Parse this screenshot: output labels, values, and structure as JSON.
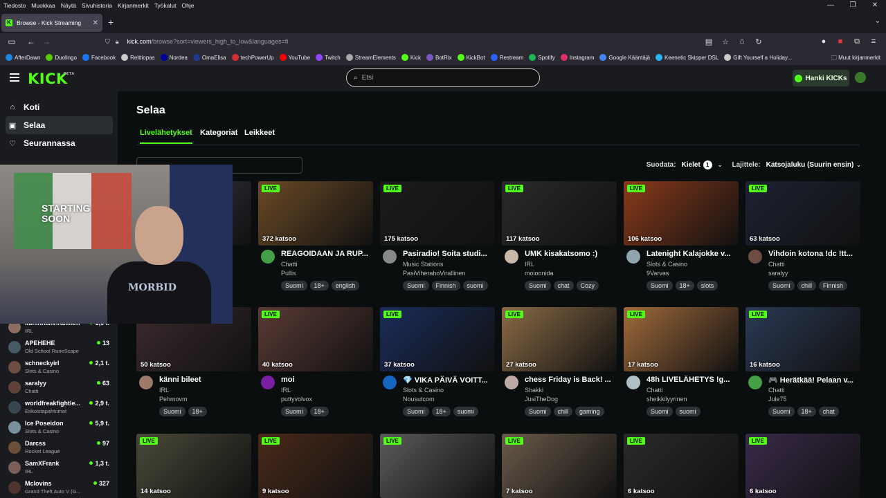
{
  "os_menu": [
    "Tiedosto",
    "Muokkaa",
    "Näytä",
    "Sivuhistoria",
    "Kirjanmerkit",
    "Työkalut",
    "Ohje"
  ],
  "browser": {
    "tab_title": "Browse - Kick Streaming",
    "url_host": "kick.com",
    "url_path": "/browse?sort=viewers_high_to_low&languages=fi"
  },
  "bookmarks": [
    {
      "label": "AfterDawn",
      "color": "#1e88e5"
    },
    {
      "label": "Duolingo",
      "color": "#58cc02"
    },
    {
      "label": "Facebook",
      "color": "#1877f2"
    },
    {
      "label": "Reittiopas",
      "color": "#ccc"
    },
    {
      "label": "Nordea",
      "color": "#0000a0"
    },
    {
      "label": "OmaElisa",
      "color": "#1e3a8a"
    },
    {
      "label": "techPowerUp",
      "color": "#d32f2f"
    },
    {
      "label": "YouTube",
      "color": "#ff0000"
    },
    {
      "label": "Twitch",
      "color": "#9146ff"
    },
    {
      "label": "StreamElements",
      "color": "#aaa"
    },
    {
      "label": "Kick",
      "color": "#53fc18"
    },
    {
      "label": "BotRix",
      "color": "#7e57c2"
    },
    {
      "label": "KickBot",
      "color": "#53fc18"
    },
    {
      "label": "Restream",
      "color": "#2962ff"
    },
    {
      "label": "Spotify",
      "color": "#1db954"
    },
    {
      "label": "Instagram",
      "color": "#e1306c"
    },
    {
      "label": "Google Kääntäjä",
      "color": "#4285f4"
    },
    {
      "label": "Keenetic Skipper DSL",
      "color": "#29b6f6"
    },
    {
      "label": "Gift Yourself a Holiday...",
      "color": "#ccc"
    }
  ],
  "bookmarks_other": "Muut kirjanmerkit",
  "header": {
    "logo": "KICK",
    "logo_beta": "BETA",
    "search_placeholder": "Etsi",
    "kicks_button": "Hanki KICKs"
  },
  "sidebar": {
    "nav": [
      {
        "label": "Koti",
        "icon": "home-icon"
      },
      {
        "label": "Selaa",
        "icon": "browse-icon"
      },
      {
        "label": "Seurannassa",
        "icon": "heart-icon"
      }
    ],
    "channels": [
      {
        "name": "kuninnanvirallinen",
        "category": "IRL",
        "viewers": "1,6 t.",
        "color": "#8d6e63"
      },
      {
        "name": "APEHEHE",
        "category": "Old School RuneScape",
        "viewers": "13",
        "color": "#455a64"
      },
      {
        "name": "schneckyirl",
        "category": "Slots & Casino",
        "viewers": "2,1 t.",
        "color": "#6d4c41"
      },
      {
        "name": "saralyy",
        "category": "Chatti",
        "viewers": "63",
        "color": "#5d4037"
      },
      {
        "name": "worldfreakfightle...",
        "category": "Erikoistapahtumat",
        "viewers": "2,9 t.",
        "color": "#37474f"
      },
      {
        "name": "Ice Poseidon",
        "category": "Slots & Casino",
        "viewers": "5,9 t.",
        "color": "#78909c"
      },
      {
        "name": "Darcss",
        "category": "Rocket League",
        "viewers": "97",
        "color": "#6a4f3b"
      },
      {
        "name": "SamXFrank",
        "category": "IRL",
        "viewers": "1,3 t.",
        "color": "#7b5e57"
      },
      {
        "name": "Mclovins",
        "category": "Grand Theft Auto V (G...",
        "viewers": "327",
        "color": "#4e342e"
      }
    ]
  },
  "main": {
    "title": "Selaa",
    "tabs": [
      "Livelähetykset",
      "Kategoriat",
      "Leikkeet"
    ],
    "tag_search_placeholder": "Hae tunnisteita",
    "filter_label": "Suodata:",
    "filter_languages": "Kielet",
    "filter_count": "1",
    "sort_label": "Lajittele:",
    "sort_value": "Katsojaluku (Suurin ensin)"
  },
  "live_badge": "LIVE",
  "cards": [
    {
      "viewers": "",
      "title": "",
      "category": "",
      "user": "",
      "tags": [],
      "thumb": "#3a3a4a",
      "avatar": "#555"
    },
    {
      "viewers": "372 katsoo",
      "title": "REAGOIDAAN JA RUP...",
      "category": "Chatti",
      "user": "Pullis",
      "tags": [
        "Suomi",
        "18+",
        "english"
      ],
      "thumb": "#6b4a25",
      "avatar": "#43a047"
    },
    {
      "viewers": "175 katsoo",
      "title": "Pasiradio! Soita studi...",
      "category": "Music Stations",
      "user": "PasiViherahoVirallinen",
      "tags": [
        "Suomi",
        "Finnish",
        "suomi"
      ],
      "thumb": "#1b1b1b",
      "avatar": "#888"
    },
    {
      "viewers": "117 katsoo",
      "title": "UMK kisakatsomo :)",
      "category": "IRL",
      "user": "moioonida",
      "tags": [
        "Suomi",
        "chat",
        "Cozy"
      ],
      "thumb": "#2a2a2c",
      "avatar": "#c8b8a8"
    },
    {
      "viewers": "106 katsoo",
      "title": "Latenight Kalajokke v...",
      "category": "Slots & Casino",
      "user": "9Varvas",
      "tags": [
        "Suomi",
        "18+",
        "slots"
      ],
      "thumb": "#8a3a1a",
      "avatar": "#90a4ae"
    },
    {
      "viewers": "63 katsoo",
      "title": "Vihdoin kotona !dc !tt...",
      "category": "Chatti",
      "user": "saralyy",
      "tags": [
        "Suomi",
        "chill",
        "Finnish"
      ],
      "thumb": "#1e2233",
      "avatar": "#6d4c41"
    },
    {
      "viewers": "50 katsoo",
      "title": "känni bileet",
      "category": "IRL",
      "user": "Pehmovm",
      "tags": [
        "Suomi",
        "18+"
      ],
      "thumb": "#3b2a2e",
      "avatar": "#9e7a6a"
    },
    {
      "viewers": "40 katsoo",
      "title": "moi",
      "category": "IRL",
      "user": "puttyvolvox",
      "tags": [
        "Suomi",
        "18+"
      ],
      "thumb": "#5a3a35",
      "avatar": "#7b1fa2"
    },
    {
      "viewers": "37 katsoo",
      "title": "💎 VIKA PÄIVÄ VOITT...",
      "category": "Slots & Casino",
      "user": "Nousutcom",
      "tags": [
        "Suomi",
        "18+",
        "suomi"
      ],
      "thumb": "#1a2c5a",
      "avatar": "#1565c0"
    },
    {
      "viewers": "27 katsoo",
      "title": "chess Friday is Back! ...",
      "category": "Shakki",
      "user": "JusiTheDog",
      "tags": [
        "Suomi",
        "chill",
        "gaming"
      ],
      "thumb": "#8a6a45",
      "avatar": "#bcaaa4"
    },
    {
      "viewers": "17 katsoo",
      "title": "48h LIVELÄHETYS !g...",
      "category": "Chatti",
      "user": "sheikkilyyrinen",
      "tags": [
        "Suomi",
        "suomi"
      ],
      "thumb": "#a06a3a",
      "avatar": "#b0bec5"
    },
    {
      "viewers": "16 katsoo",
      "title": "🎮 Herätkää! Pelaan v...",
      "category": "Chatti",
      "user": "Jule75",
      "tags": [
        "Suomi",
        "18+",
        "chat"
      ],
      "thumb": "#2b3a55",
      "avatar": "#43a047"
    },
    {
      "viewers": "14 katsoo",
      "title": "",
      "category": "",
      "user": "",
      "tags": [],
      "thumb": "#4a4a3a",
      "avatar": "#555"
    },
    {
      "viewers": "9 katsoo",
      "title": "",
      "category": "",
      "user": "",
      "tags": [],
      "thumb": "#4a2a1a",
      "avatar": "#555"
    },
    {
      "viewers": "",
      "title": "",
      "category": "",
      "user": "",
      "tags": [],
      "thumb": "#5a5a5a",
      "avatar": "#555"
    },
    {
      "viewers": "7 katsoo",
      "title": "",
      "category": "",
      "user": "",
      "tags": [],
      "thumb": "#6a5a4a",
      "avatar": "#555"
    },
    {
      "viewers": "6 katsoo",
      "title": "",
      "category": "",
      "user": "",
      "tags": [],
      "thumb": "#2a2a2a",
      "avatar": "#555"
    },
    {
      "viewers": "6 katsoo",
      "title": "",
      "category": "",
      "user": "",
      "tags": [],
      "thumb": "#3a2a4a",
      "avatar": "#555"
    }
  ],
  "webcam_overlay": {
    "poster_text_line1": "STARTING",
    "poster_text_line2": "SOON"
  },
  "colors": {
    "accent": "#53fc18",
    "background": "#0b0e0f",
    "panel": "#191b1f"
  }
}
